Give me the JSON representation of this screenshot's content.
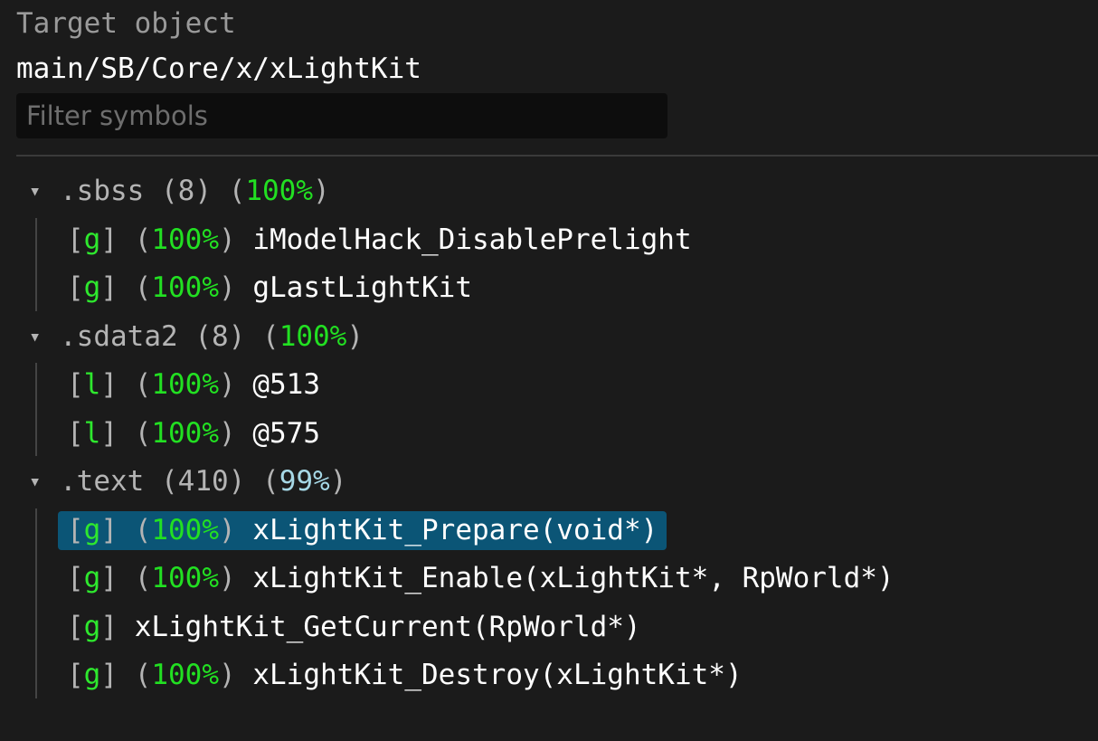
{
  "header": {
    "label": "Target object",
    "path": "main/SB/Core/x/xLightKit"
  },
  "filter": {
    "placeholder": "Filter symbols",
    "value": ""
  },
  "colors": {
    "background": "#1b1b1b",
    "match_full": "#22e022",
    "match_partial": "#a6d8e6",
    "selection": "#0b5576",
    "symbol_kind": "#2ee82e",
    "muted_text": "#b4b4b4"
  },
  "icons": {
    "expand": "chevron-down-icon"
  },
  "sections": [
    {
      "name": ".sbss",
      "count": "8",
      "percent": "100%",
      "expand_glyph": "▾",
      "symbols": [
        {
          "kind": "g",
          "percent": "100%",
          "name": "iModelHack_DisablePrelight",
          "selected": false
        },
        {
          "kind": "g",
          "percent": "100%",
          "name": "gLastLightKit",
          "selected": false
        }
      ]
    },
    {
      "name": ".sdata2",
      "count": "8",
      "percent": "100%",
      "expand_glyph": "▾",
      "symbols": [
        {
          "kind": "l",
          "percent": "100%",
          "name": "@513",
          "selected": false
        },
        {
          "kind": "l",
          "percent": "100%",
          "name": "@575",
          "selected": false
        }
      ]
    },
    {
      "name": ".text",
      "count": "410",
      "percent": "99%",
      "expand_glyph": "▾",
      "symbols": [
        {
          "kind": "g",
          "percent": "100%",
          "name": "xLightKit_Prepare(void*)",
          "selected": true
        },
        {
          "kind": "g",
          "percent": "100%",
          "name": "xLightKit_Enable(xLightKit*, RpWorld*)",
          "selected": false
        },
        {
          "kind": "g",
          "percent": "",
          "name": "xLightKit_GetCurrent(RpWorld*)",
          "selected": false
        },
        {
          "kind": "g",
          "percent": "100%",
          "name": "xLightKit_Destroy(xLightKit*)",
          "selected": false
        }
      ]
    }
  ]
}
